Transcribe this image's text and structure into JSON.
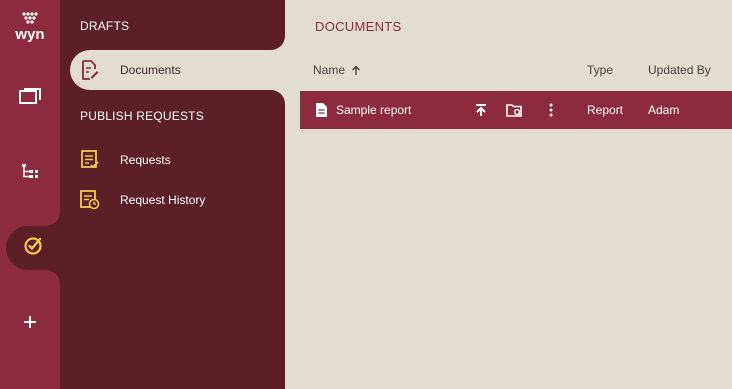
{
  "app": {
    "logo_text": "wyn",
    "colors": {
      "rail": "#8c2b3f",
      "nav": "#5c1e27",
      "content": "#e2ddd0",
      "accent_icon": "#f2c94c"
    }
  },
  "rail": {
    "items": [
      {
        "name": "documents-icon"
      },
      {
        "name": "hierarchy-icon"
      },
      {
        "name": "publish-icon",
        "active": true
      },
      {
        "name": "plus-icon"
      }
    ]
  },
  "nav": {
    "drafts_heading": "DRAFTS",
    "documents_label": "Documents",
    "publish_heading": "PUBLISH REQUESTS",
    "requests_label": "Requests",
    "history_label": "Request History"
  },
  "main": {
    "title": "DOCUMENTS",
    "columns": {
      "name": "Name",
      "type": "Type",
      "updated_by": "Updated By"
    },
    "sort": "ascending",
    "rows": [
      {
        "name": "Sample report",
        "type": "Report",
        "updated_by": "Adam"
      }
    ]
  }
}
